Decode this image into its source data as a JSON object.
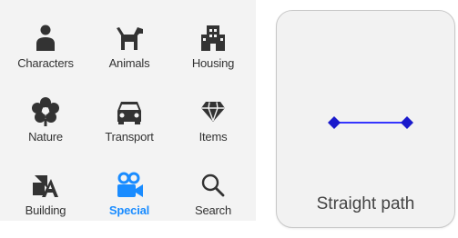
{
  "categories": [
    {
      "label": "Characters",
      "icon": "person-icon"
    },
    {
      "label": "Animals",
      "icon": "dog-icon"
    },
    {
      "label": "Housing",
      "icon": "building-icon"
    },
    {
      "label": "Nature",
      "icon": "flower-icon"
    },
    {
      "label": "Transport",
      "icon": "car-icon"
    },
    {
      "label": "Items",
      "icon": "diamond-icon"
    },
    {
      "label": "Building",
      "icon": "shapes-icon"
    },
    {
      "label": "Special",
      "icon": "camera-icon",
      "active": true
    },
    {
      "label": "Search",
      "icon": "search-icon"
    }
  ],
  "path_card": {
    "title": "Straight path",
    "icon": "straight-path-icon"
  },
  "colors": {
    "active": "#1a8cff",
    "icon": "#333333",
    "path_line": "#1a1aff",
    "path_node": "#1a1acc"
  }
}
